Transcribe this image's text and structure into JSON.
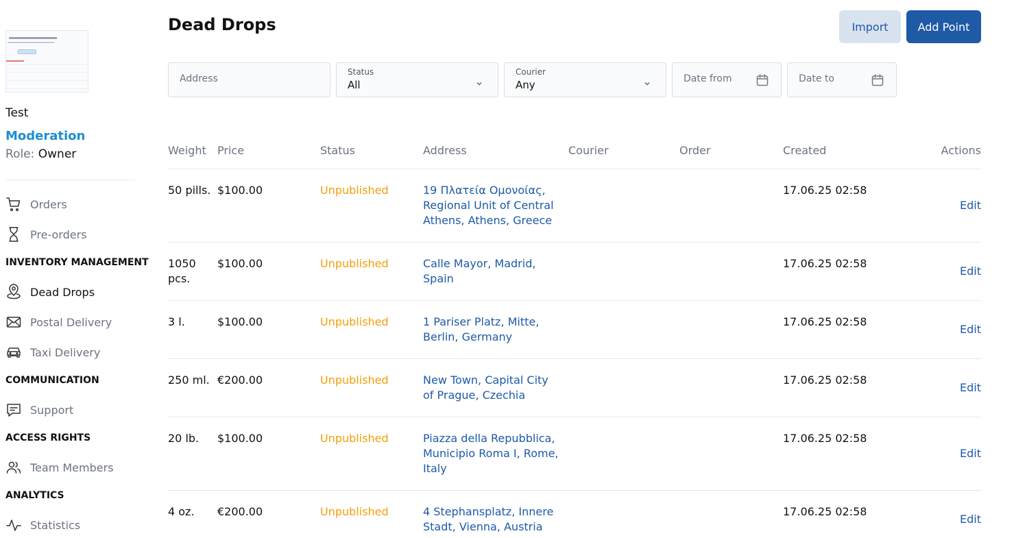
{
  "sidebar": {
    "username": "Test",
    "mode": "Moderation",
    "role_key": "Role:",
    "role_value": "Owner",
    "nav": [
      {
        "label": "Orders",
        "icon": "cart-icon"
      },
      {
        "label": "Pre-orders",
        "icon": "hourglass-icon"
      },
      {
        "section": "INVENTORY MANAGEMENT"
      },
      {
        "label": "Dead Drops",
        "icon": "map-pin-icon",
        "active": true
      },
      {
        "label": "Postal Delivery",
        "icon": "mail-icon"
      },
      {
        "label": "Taxi Delivery",
        "icon": "car-icon"
      },
      {
        "section": "COMMUNICATION"
      },
      {
        "label": "Support",
        "icon": "chat-icon"
      },
      {
        "section": "ACCESS RIGHTS"
      },
      {
        "label": "Team Members",
        "icon": "users-icon"
      },
      {
        "section": "ANALYTICS"
      },
      {
        "label": "Statistics",
        "icon": "activity-icon"
      }
    ]
  },
  "header": {
    "title": "Dead Drops",
    "import_label": "Import",
    "add_label": "Add Point"
  },
  "filters": {
    "address_placeholder": "Address",
    "status_label": "Status",
    "status_value": "All",
    "courier_label": "Courier",
    "courier_value": "Any",
    "date_from_placeholder": "Date from",
    "date_to_placeholder": "Date to"
  },
  "table": {
    "columns": [
      "Weight",
      "Price",
      "Status",
      "Address",
      "Courier",
      "Order",
      "Created",
      "Actions"
    ],
    "rows": [
      {
        "weight": "50 pills.",
        "price": "$100.00",
        "status": "Unpublished",
        "address": "19 Πλατεία Ομονοίας, Regional Unit of Central Athens, Athens, Greece",
        "courier": "",
        "order": "",
        "created": "17.06.25 02:58",
        "action": "Edit"
      },
      {
        "weight": "1050 pcs.",
        "price": "$100.00",
        "status": "Unpublished",
        "address": "Calle Mayor, Madrid, Spain",
        "courier": "",
        "order": "",
        "created": "17.06.25 02:58",
        "action": "Edit"
      },
      {
        "weight": "3 l.",
        "price": "$100.00",
        "status": "Unpublished",
        "address": "1 Pariser Platz, Mitte, Berlin, Germany",
        "courier": "",
        "order": "",
        "created": "17.06.25 02:58",
        "action": "Edit"
      },
      {
        "weight": "250 ml.",
        "price": "€200.00",
        "status": "Unpublished",
        "address": "New Town, Capital City of Prague, Czechia",
        "courier": "",
        "order": "",
        "created": "17.06.25 02:58",
        "action": "Edit"
      },
      {
        "weight": "20 lb.",
        "price": "$100.00",
        "status": "Unpublished",
        "address": "Piazza della Repubblica, Municipio Roma I, Rome, Italy",
        "courier": "",
        "order": "",
        "created": "17.06.25 02:58",
        "action": "Edit"
      },
      {
        "weight": "4 oz.",
        "price": "€200.00",
        "status": "Unpublished",
        "address": "4 Stephansplatz, Innere Stadt, Vienna, Austria",
        "courier": "",
        "order": "",
        "created": "17.06.25 02:58",
        "action": "Edit"
      }
    ]
  },
  "colors": {
    "accent": "#1f5aa6",
    "mode": "#1a8fd1",
    "status_unpublished": "#f59e0b"
  }
}
